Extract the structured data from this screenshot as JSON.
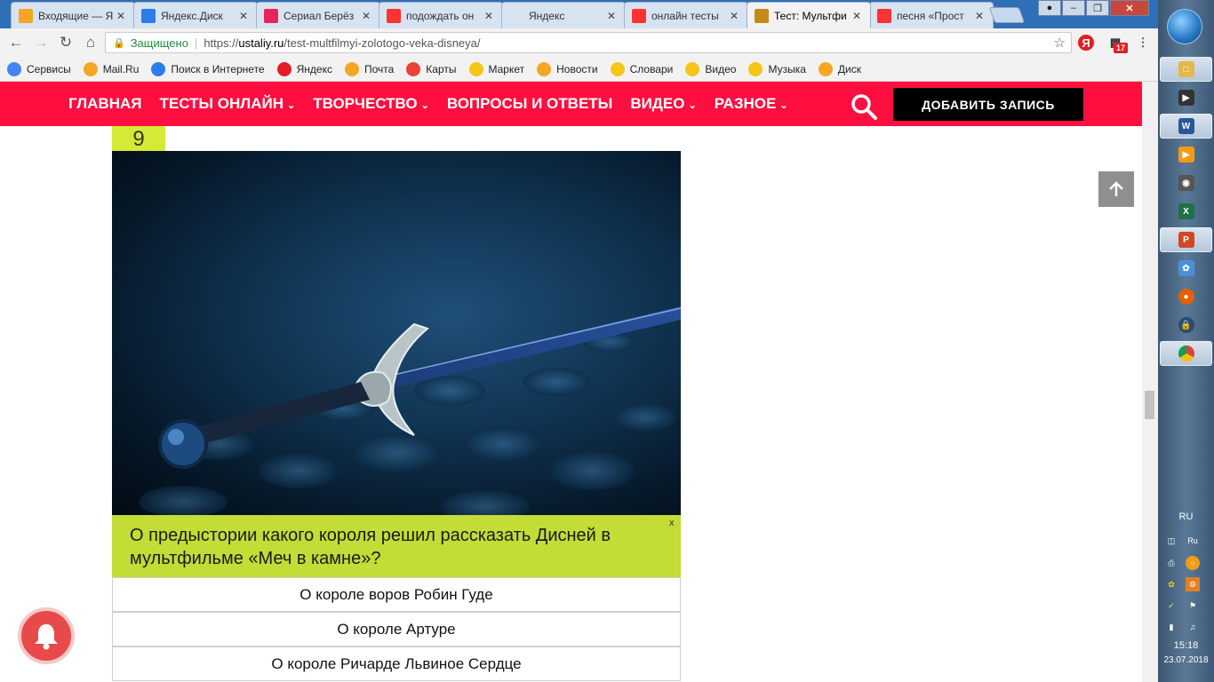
{
  "browser": {
    "tabs": [
      {
        "title": "Входящие — Я",
        "favicon": "mail-icon",
        "color": "#f5a623"
      },
      {
        "title": "Яндекс.Диск",
        "favicon": "disk-icon",
        "color": "#2b7de9"
      },
      {
        "title": "Сериал Берёз",
        "favicon": "ivi-icon",
        "color": "#e5265c"
      },
      {
        "title": "подождать он",
        "favicon": "yandex-icon",
        "color": "#ff3333"
      },
      {
        "title": "Яндекс",
        "favicon": "blank-icon",
        "color": "#d7e3f1"
      },
      {
        "title": "онлайн тесты",
        "favicon": "yandex-icon",
        "color": "#ff3333"
      },
      {
        "title": "Тест: Мультфи",
        "favicon": "site-icon",
        "color": "#c58b1a",
        "active": true
      },
      {
        "title": "песня «Прост",
        "favicon": "yandex-icon",
        "color": "#ff3333"
      }
    ],
    "address": {
      "secure_label": "Защищено",
      "url_scheme": "https://",
      "url_host": "ustaliy.ru",
      "url_path": "/test-multfilmyi-zolotogo-veka-disneya/"
    },
    "extension_badge": "17",
    "bookmarks": [
      {
        "label": "Сервисы",
        "icon": "apps-icon"
      },
      {
        "label": "Mail.Ru",
        "icon": "mailru-icon"
      },
      {
        "label": "Поиск в Интернете",
        "icon": "search-icon"
      },
      {
        "label": "Яндекс",
        "icon": "yandex-icon"
      },
      {
        "label": "Почта",
        "icon": "mail-icon"
      },
      {
        "label": "Карты",
        "icon": "google-icon"
      },
      {
        "label": "Маркет",
        "icon": "market-icon"
      },
      {
        "label": "Новости",
        "icon": "mailru-icon"
      },
      {
        "label": "Словари",
        "icon": "dictionary-icon"
      },
      {
        "label": "Видео",
        "icon": "video-icon"
      },
      {
        "label": "Музыка",
        "icon": "music-icon"
      },
      {
        "label": "Диск",
        "icon": "mailru-icon"
      }
    ]
  },
  "site": {
    "nav": [
      {
        "label": "ГЛАВНАЯ",
        "dropdown": false
      },
      {
        "label": "ТЕСТЫ ОНЛАЙН",
        "dropdown": true
      },
      {
        "label": "ТВОРЧЕСТВО",
        "dropdown": true
      },
      {
        "label": "ВОПРОСЫ И ОТВЕТЫ",
        "dropdown": false
      },
      {
        "label": "ВИДЕО",
        "dropdown": true
      },
      {
        "label": "РАЗНОЕ",
        "dropdown": true
      }
    ],
    "add_button": "ДОБАВИТЬ ЗАПИСЬ",
    "accent": "#ff0f3f"
  },
  "quiz": {
    "number": "9",
    "question": "О предыстории какого короля решил рассказать Дисней в мультфильме «Меч в камне»?",
    "close_label": "x",
    "answers": [
      "О короле воров Робин Гуде",
      "О короле Артуре",
      "О короле Ричарде Львиное Сердце"
    ]
  },
  "taskbar": {
    "lang": "RU",
    "lang_short": "Ru",
    "time": "15:18",
    "date": "23.07.2018"
  }
}
